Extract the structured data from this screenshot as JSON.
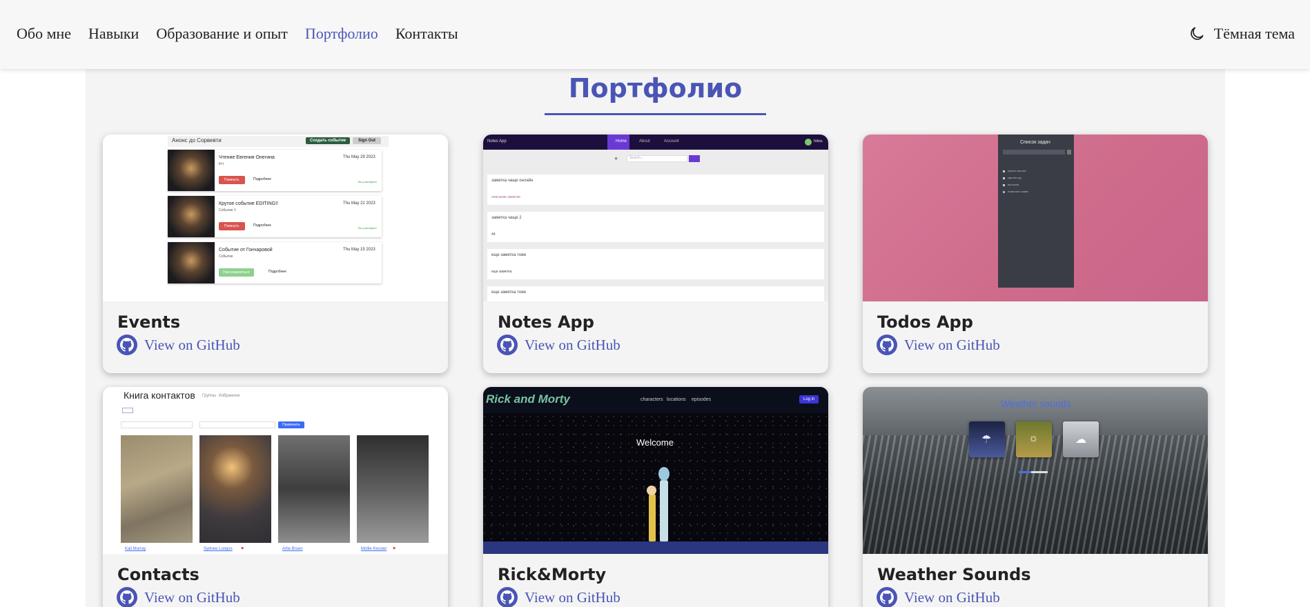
{
  "nav": {
    "items": [
      "Обо мне",
      "Навыки",
      "Образование и опыт",
      "Портфолио",
      "Контакты"
    ],
    "active_index": 3,
    "theme_label": "Тёмная тема"
  },
  "portfolio": {
    "title": "Портфолио",
    "link_label": "View on GitHub",
    "projects": [
      {
        "name": "Events"
      },
      {
        "name": "Notes App"
      },
      {
        "name": "Todos App"
      },
      {
        "name": "Contacts"
      },
      {
        "name": "Rick&Morty"
      },
      {
        "name": "Weather Sounds"
      }
    ]
  },
  "previews": {
    "events": {
      "header": "Анонс до Сорвевти",
      "create_btn": "Создать событие",
      "signout_btn": "Sign Out",
      "rows": [
        {
          "title": "Чтение Евгения Онегина",
          "date": "Thu May 29 2023",
          "desc": "Ктт",
          "btn1": "Покинуть",
          "btn2": "Подробнее",
          "tag": "Вы участвуете"
        },
        {
          "title": "Крутое событие EDITING!!",
          "date": "Thu May 22 2023",
          "desc": "Событие 1",
          "btn1": "Покинуть",
          "btn2": "Подробнее",
          "tag": "Вы участвуете"
        },
        {
          "title": "Событие от Гончаровой",
          "date": "Thu May 15 2023",
          "desc": "Событие",
          "btn1": "Присоединиться",
          "btn2": "Подробнее",
          "tag": ""
        }
      ]
    },
    "notes": {
      "brand": "Notes App",
      "tabs": [
        "Home",
        "About",
        "Account"
      ],
      "search_placeholder": "Search...",
      "user": "Nikita",
      "notes": [
        {
          "title": "заметка чаще онлайн",
          "body": "описание заметки"
        },
        {
          "title": "заметка чаще 2",
          "body": "44"
        },
        {
          "title": "еще заметка тоже",
          "body": "еще заметка"
        },
        {
          "title": "еще заметка тоже",
          "body": ""
        }
      ]
    },
    "todos": {
      "title": "Список задач",
      "items": [
        "купить молоко",
        "сделать дз",
        "прогулка",
        "позвонить маме"
      ]
    },
    "contacts": {
      "title": "Книга контактов",
      "tabs": [
        "Группы",
        "Избранное"
      ],
      "btn": "Применить",
      "people": [
        {
          "name": "Kali Murray",
          "fav": false
        },
        {
          "name": "Sydnee Longos",
          "fav": true
        },
        {
          "name": "Arlie Bruen",
          "fav": false
        },
        {
          "name": "Mollie Kessler",
          "fav": true
        }
      ]
    },
    "rickmorty": {
      "logo": "Rick and Morty",
      "links": [
        "characters",
        "locations",
        "episodes"
      ],
      "login": "Log in",
      "welcome": "Welcome"
    },
    "weather": {
      "title": "Weather sounds"
    }
  },
  "colors": {
    "accent": "#4a55b5",
    "todos_bg": "#d07090",
    "rm_bg": "#07070d",
    "events_green": "#2a5d3e",
    "notes_purple": "#6a39d4"
  }
}
